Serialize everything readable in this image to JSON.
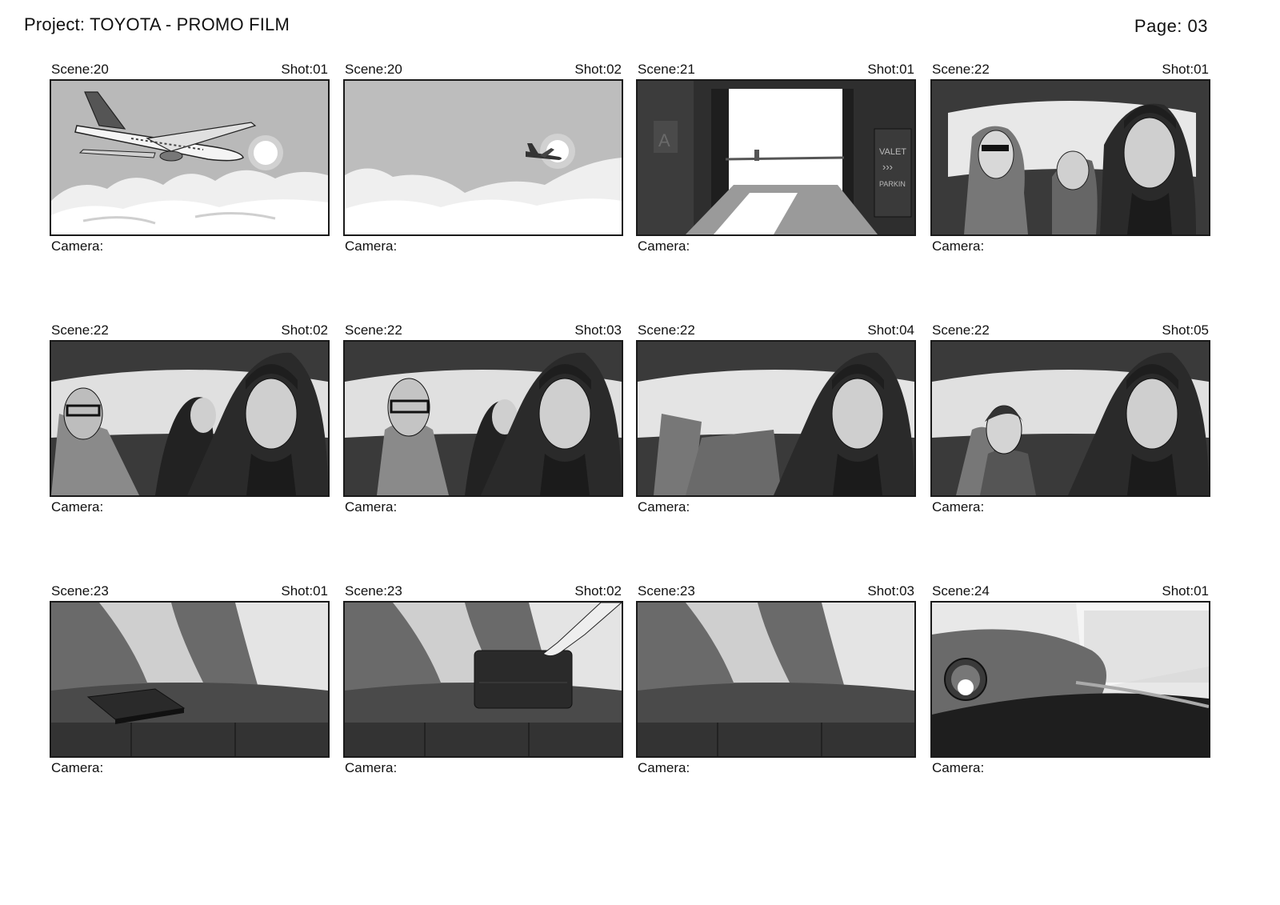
{
  "header": {
    "project": "Project: TOYOTA - PROMO FILM",
    "page": "Page: 03"
  },
  "rows": [
    {
      "cells": [
        {
          "scene": "Scene:20",
          "shot": "Shot:01",
          "camera": "Camera:"
        },
        {
          "scene": "Scene:20",
          "shot": "Shot:02",
          "camera": "Camera:"
        },
        {
          "scene": "Scene:21",
          "shot": "Shot:01",
          "camera": "Camera:"
        },
        {
          "scene": "Scene:22",
          "shot": "Shot:01",
          "camera": "Camera:"
        }
      ]
    },
    {
      "cells": [
        {
          "scene": "Scene:22",
          "shot": "Shot:02",
          "camera": "Camera:"
        },
        {
          "scene": "Scene:22",
          "shot": "Shot:03",
          "camera": "Camera:"
        },
        {
          "scene": "Scene:22",
          "shot": "Shot:04",
          "camera": "Camera:"
        },
        {
          "scene": "Scene:22",
          "shot": "Shot:05",
          "camera": "Camera:"
        }
      ]
    },
    {
      "cells": [
        {
          "scene": "Scene:23",
          "shot": "Shot:01",
          "camera": "Camera:"
        },
        {
          "scene": "Scene:23",
          "shot": "Shot:02",
          "camera": "Camera:"
        },
        {
          "scene": "Scene:23",
          "shot": "Shot:03",
          "camera": "Camera:"
        },
        {
          "scene": "Scene:24",
          "shot": "Shot:01",
          "camera": "Camera:"
        }
      ]
    }
  ],
  "illustration_text": {
    "valet_sign": "VALET",
    "parking_sign": "PARKIN",
    "door_letter": "A"
  }
}
